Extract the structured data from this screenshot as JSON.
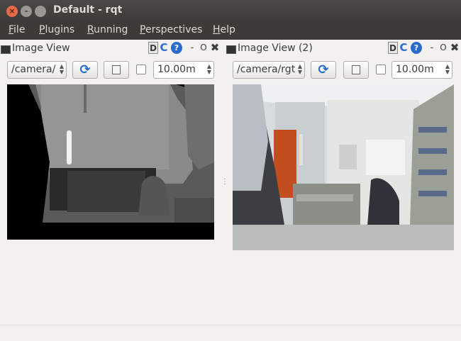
{
  "window": {
    "title": "Default - rqt"
  },
  "menu": {
    "items": [
      {
        "underline": "F",
        "rest": "ile"
      },
      {
        "underline": "P",
        "rest": "lugins"
      },
      {
        "underline": "R",
        "rest": "unning"
      },
      {
        "underline": "P",
        "rest": "erspectives"
      },
      {
        "underline": "H",
        "rest": "elp"
      }
    ]
  },
  "docks": [
    {
      "title": "Image View",
      "topic": "/camera/",
      "value": "10.00m",
      "buttons": {
        "d": "D",
        "c": "C",
        "help": "?",
        "dash": "-",
        "o": "O",
        "x": "✖"
      }
    },
    {
      "title": "Image View (2)",
      "topic": "/camera/rgt",
      "value": "10.00m",
      "buttons": {
        "d": "D",
        "c": "C",
        "help": "?",
        "dash": "-",
        "o": "O",
        "x": "✖"
      }
    }
  ],
  "splitter": {
    "glyph": "⋮"
  },
  "colors": {
    "titlebar": "#3c3b37",
    "accent": "#2a6bd0",
    "close": "#e8694a",
    "background": "#f2f1f0"
  }
}
